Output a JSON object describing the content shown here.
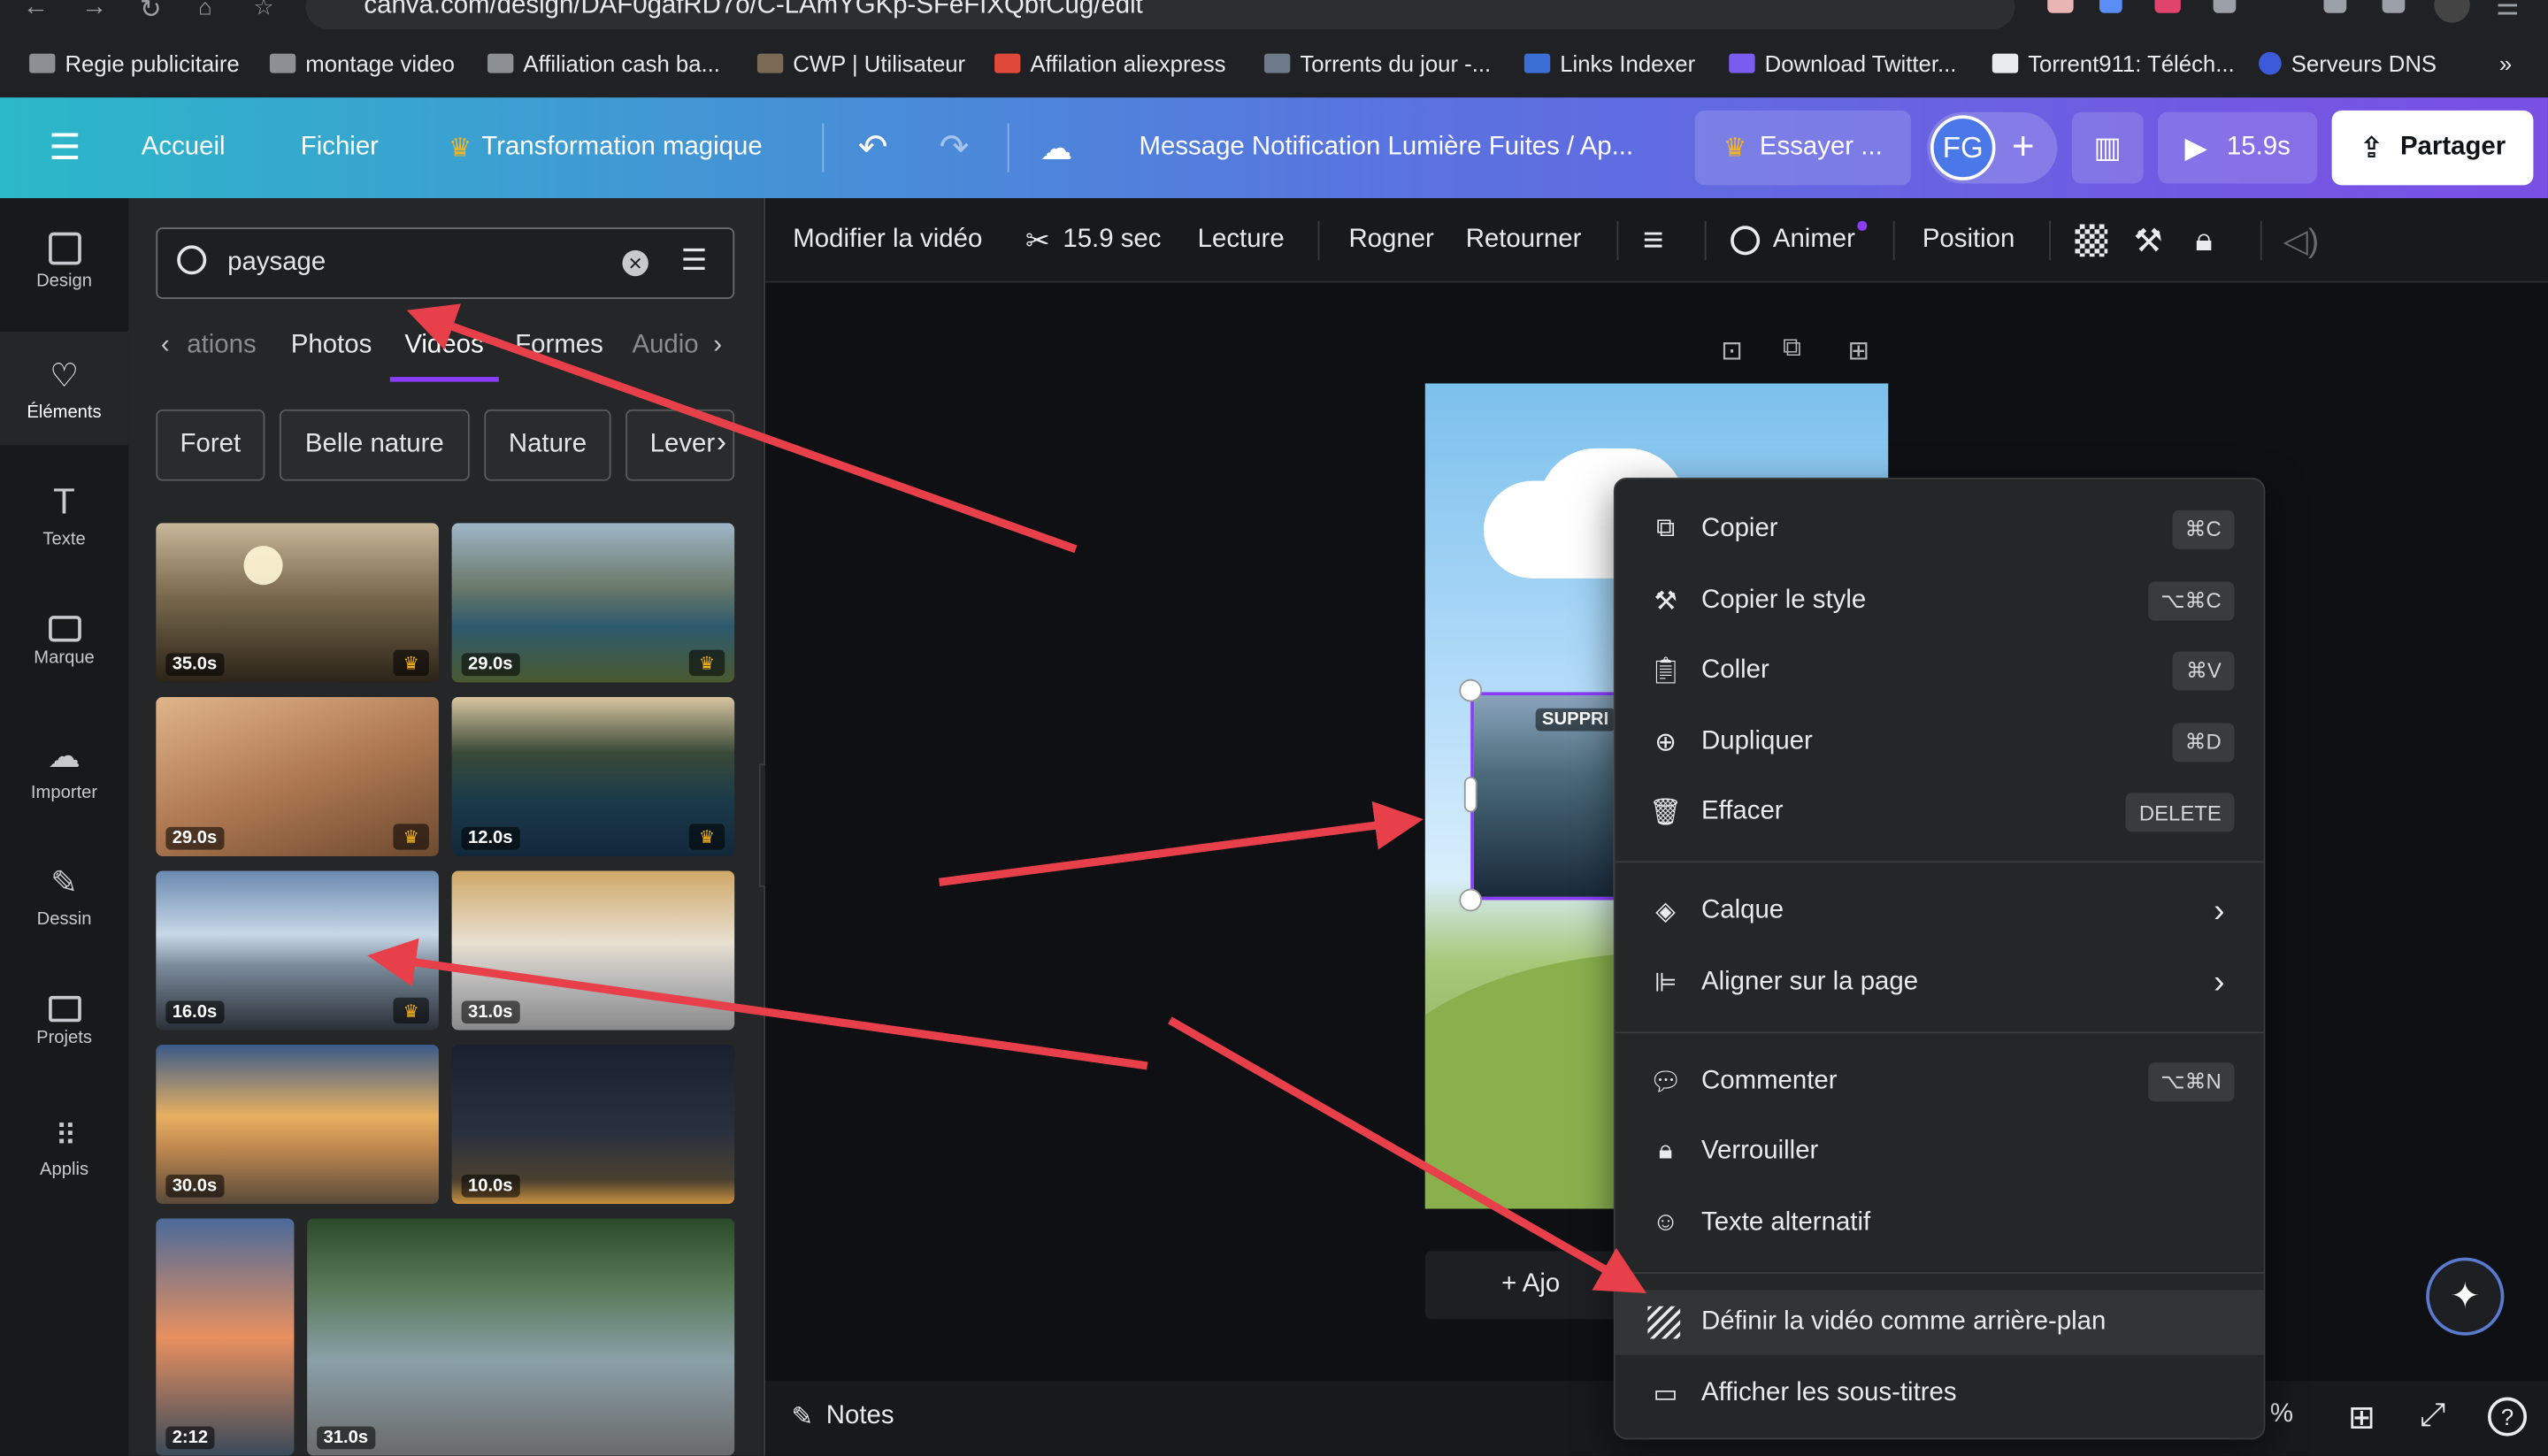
{
  "browser": {
    "url": "canva.com/design/DAF0gafRD7o/C-LAmYGKp-SFeFIXQbfCug/edit",
    "bookmarks": [
      "Regie publicitaire",
      "montage video",
      "Affiliation cash ba...",
      "CWP | Utilisateur",
      "Affilation aliexpress",
      "Torrents du jour -...",
      "Links Indexer",
      "Download Twitter...",
      "Torrent911: Téléch...",
      "Serveurs DNS"
    ],
    "more": "»"
  },
  "header": {
    "home": "Accueil",
    "file": "Fichier",
    "magic": "Transformation magique",
    "doc_title": "Message Notification Lumière Fuites / Ap...",
    "try_btn": "Essayer ...",
    "avatar": "FG",
    "plus": "+",
    "play_duration": "15.9s",
    "share": "Partager"
  },
  "rail": {
    "items": [
      "Design",
      "Éléments",
      "Texte",
      "Marque",
      "Importer",
      "Dessin",
      "Projets",
      "Applis"
    ]
  },
  "panel": {
    "search_value": "paysage",
    "tabs": [
      "ations",
      "Photos",
      "Videos",
      "Formes",
      "Audio"
    ],
    "chips": [
      "Foret",
      "Belle nature",
      "Nature",
      "Lever"
    ],
    "thumbs": [
      "35.0s",
      "29.0s",
      "29.0s",
      "12.0s",
      "16.0s",
      "31.0s",
      "30.0s",
      "10.0s",
      "2:12",
      "31.0s"
    ]
  },
  "toolbar": {
    "edit_video": "Modifier la vidéo",
    "duration": "15.9 sec",
    "playback": "Lecture",
    "crop": "Rogner",
    "flip": "Retourner",
    "animate": "Animer",
    "position": "Position"
  },
  "canvas": {
    "selected_label": "SUPPRI",
    "add_page": "+ Ajo"
  },
  "menu": {
    "items": [
      {
        "label": "Copier",
        "shortcut": "⌘C"
      },
      {
        "label": "Copier le style",
        "shortcut": "⌥⌘C"
      },
      {
        "label": "Coller",
        "shortcut": "⌘V"
      },
      {
        "label": "Dupliquer",
        "shortcut": "⌘D"
      },
      {
        "label": "Effacer",
        "shortcut": "DELETE"
      },
      {
        "label": "Calque",
        "shortcut": ""
      },
      {
        "label": "Aligner sur la page",
        "shortcut": ""
      },
      {
        "label": "Commenter",
        "shortcut": "⌥⌘N"
      },
      {
        "label": "Verrouiller",
        "shortcut": ""
      },
      {
        "label": "Texte alternatif",
        "shortcut": ""
      },
      {
        "label": "Définir la vidéo comme arrière-plan",
        "shortcut": ""
      },
      {
        "label": "Afficher les sous-titres",
        "shortcut": ""
      }
    ]
  },
  "bottom": {
    "notes": "Notes",
    "zoom_suffix": "%",
    "help": "?"
  },
  "colors": {
    "accent": "#8b3dff",
    "arrow": "#e8404a",
    "crown": "#f5b623"
  }
}
